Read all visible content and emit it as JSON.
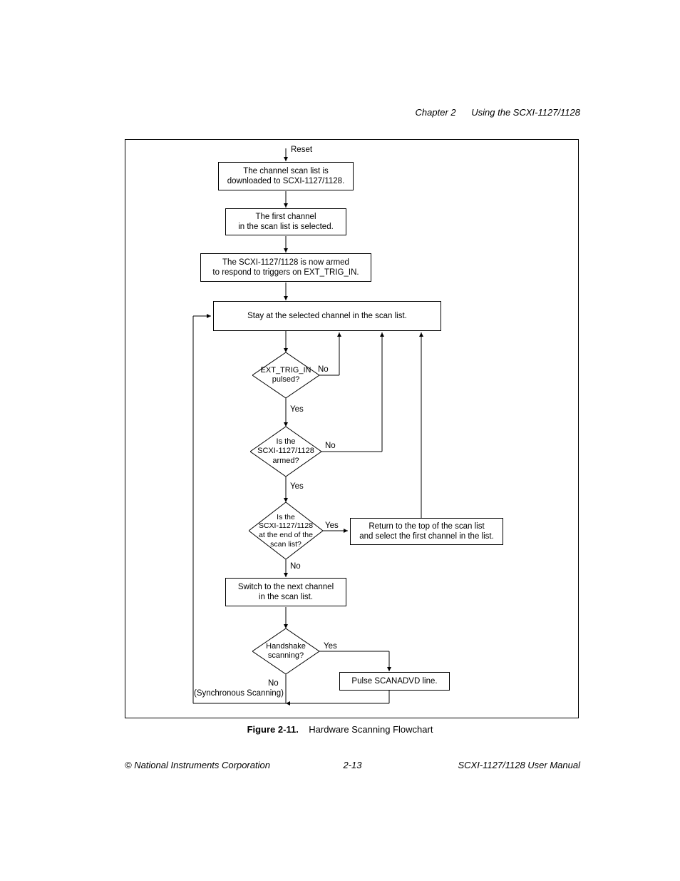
{
  "header": {
    "chapter": "Chapter 2",
    "title": "Using the SCXI-1127/1128"
  },
  "flow": {
    "reset": "Reset",
    "box1_l1": "The channel scan list is",
    "box1_l2": "downloaded to SCXI-1127/1128.",
    "box2_l1": "The first channel",
    "box2_l2": "in the scan list is selected.",
    "box3_l1": "The SCXI-1127/1128 is now armed",
    "box3_l2": "to respond to triggers on EXT_TRIG_IN.",
    "box4": "Stay at the selected channel in the scan list.",
    "d1_l1": "EXT_TRIG_IN",
    "d1_l2": "pulsed?",
    "d2_l1": "Is the",
    "d2_l2": "SCXI-1127/1128",
    "d2_l3": "armed?",
    "d3_l1": "Is the",
    "d3_l2": "SCXI-1127/1128",
    "d3_l3": "at the end of the",
    "d3_l4": "scan list?",
    "box5_l1": "Return to the top of the scan list",
    "box5_l2": "and select the first channel in the list.",
    "box6_l1": "Switch to the next channel",
    "box6_l2": "in the scan list.",
    "d4_l1": "Handshake",
    "d4_l2": "scanning?",
    "box7": "Pulse SCANADVD line.",
    "yes": "Yes",
    "no": "No",
    "sync": "(Synchronous Scanning)"
  },
  "caption": {
    "fig": "Figure 2-11.",
    "text": "Hardware Scanning Flowchart"
  },
  "footer": {
    "left": "© National Instruments Corporation",
    "center": "2-13",
    "right": "SCXI-1127/1128 User Manual"
  }
}
